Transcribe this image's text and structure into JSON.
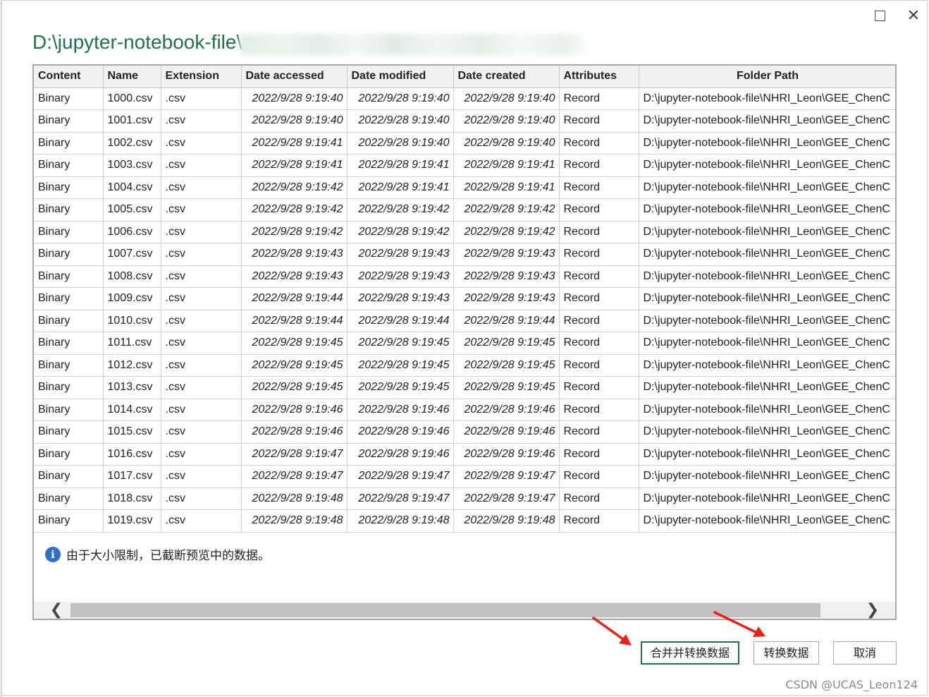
{
  "window": {
    "title": "D:\\jupyter-notebook-file\\",
    "maximize_icon": "maximize-icon",
    "close_icon": "close-icon",
    "close_glyph": "✕"
  },
  "table": {
    "columns": [
      "Content",
      "Name",
      "Extension",
      "Date accessed",
      "Date modified",
      "Date created",
      "Attributes",
      "Folder Path"
    ],
    "rows": [
      [
        "Binary",
        "1000.csv",
        ".csv",
        "2022/9/28 9:19:40",
        "2022/9/28 9:19:40",
        "2022/9/28 9:19:40",
        "Record",
        "D:\\jupyter-notebook-file\\NHRI_Leon\\GEE_ChenC"
      ],
      [
        "Binary",
        "1001.csv",
        ".csv",
        "2022/9/28 9:19:40",
        "2022/9/28 9:19:40",
        "2022/9/28 9:19:40",
        "Record",
        "D:\\jupyter-notebook-file\\NHRI_Leon\\GEE_ChenC"
      ],
      [
        "Binary",
        "1002.csv",
        ".csv",
        "2022/9/28 9:19:41",
        "2022/9/28 9:19:40",
        "2022/9/28 9:19:40",
        "Record",
        "D:\\jupyter-notebook-file\\NHRI_Leon\\GEE_ChenC"
      ],
      [
        "Binary",
        "1003.csv",
        ".csv",
        "2022/9/28 9:19:41",
        "2022/9/28 9:19:41",
        "2022/9/28 9:19:41",
        "Record",
        "D:\\jupyter-notebook-file\\NHRI_Leon\\GEE_ChenC"
      ],
      [
        "Binary",
        "1004.csv",
        ".csv",
        "2022/9/28 9:19:42",
        "2022/9/28 9:19:41",
        "2022/9/28 9:19:41",
        "Record",
        "D:\\jupyter-notebook-file\\NHRI_Leon\\GEE_ChenC"
      ],
      [
        "Binary",
        "1005.csv",
        ".csv",
        "2022/9/28 9:19:42",
        "2022/9/28 9:19:42",
        "2022/9/28 9:19:42",
        "Record",
        "D:\\jupyter-notebook-file\\NHRI_Leon\\GEE_ChenC"
      ],
      [
        "Binary",
        "1006.csv",
        ".csv",
        "2022/9/28 9:19:42",
        "2022/9/28 9:19:42",
        "2022/9/28 9:19:42",
        "Record",
        "D:\\jupyter-notebook-file\\NHRI_Leon\\GEE_ChenC"
      ],
      [
        "Binary",
        "1007.csv",
        ".csv",
        "2022/9/28 9:19:43",
        "2022/9/28 9:19:43",
        "2022/9/28 9:19:43",
        "Record",
        "D:\\jupyter-notebook-file\\NHRI_Leon\\GEE_ChenC"
      ],
      [
        "Binary",
        "1008.csv",
        ".csv",
        "2022/9/28 9:19:43",
        "2022/9/28 9:19:43",
        "2022/9/28 9:19:43",
        "Record",
        "D:\\jupyter-notebook-file\\NHRI_Leon\\GEE_ChenC"
      ],
      [
        "Binary",
        "1009.csv",
        ".csv",
        "2022/9/28 9:19:44",
        "2022/9/28 9:19:43",
        "2022/9/28 9:19:43",
        "Record",
        "D:\\jupyter-notebook-file\\NHRI_Leon\\GEE_ChenC"
      ],
      [
        "Binary",
        "1010.csv",
        ".csv",
        "2022/9/28 9:19:44",
        "2022/9/28 9:19:44",
        "2022/9/28 9:19:44",
        "Record",
        "D:\\jupyter-notebook-file\\NHRI_Leon\\GEE_ChenC"
      ],
      [
        "Binary",
        "1011.csv",
        ".csv",
        "2022/9/28 9:19:45",
        "2022/9/28 9:19:45",
        "2022/9/28 9:19:45",
        "Record",
        "D:\\jupyter-notebook-file\\NHRI_Leon\\GEE_ChenC"
      ],
      [
        "Binary",
        "1012.csv",
        ".csv",
        "2022/9/28 9:19:45",
        "2022/9/28 9:19:45",
        "2022/9/28 9:19:45",
        "Record",
        "D:\\jupyter-notebook-file\\NHRI_Leon\\GEE_ChenC"
      ],
      [
        "Binary",
        "1013.csv",
        ".csv",
        "2022/9/28 9:19:45",
        "2022/9/28 9:19:45",
        "2022/9/28 9:19:45",
        "Record",
        "D:\\jupyter-notebook-file\\NHRI_Leon\\GEE_ChenC"
      ],
      [
        "Binary",
        "1014.csv",
        ".csv",
        "2022/9/28 9:19:46",
        "2022/9/28 9:19:46",
        "2022/9/28 9:19:46",
        "Record",
        "D:\\jupyter-notebook-file\\NHRI_Leon\\GEE_ChenC"
      ],
      [
        "Binary",
        "1015.csv",
        ".csv",
        "2022/9/28 9:19:46",
        "2022/9/28 9:19:46",
        "2022/9/28 9:19:46",
        "Record",
        "D:\\jupyter-notebook-file\\NHRI_Leon\\GEE_ChenC"
      ],
      [
        "Binary",
        "1016.csv",
        ".csv",
        "2022/9/28 9:19:47",
        "2022/9/28 9:19:46",
        "2022/9/28 9:19:46",
        "Record",
        "D:\\jupyter-notebook-file\\NHRI_Leon\\GEE_ChenC"
      ],
      [
        "Binary",
        "1017.csv",
        ".csv",
        "2022/9/28 9:19:47",
        "2022/9/28 9:19:47",
        "2022/9/28 9:19:47",
        "Record",
        "D:\\jupyter-notebook-file\\NHRI_Leon\\GEE_ChenC"
      ],
      [
        "Binary",
        "1018.csv",
        ".csv",
        "2022/9/28 9:19:48",
        "2022/9/28 9:19:47",
        "2022/9/28 9:19:47",
        "Record",
        "D:\\jupyter-notebook-file\\NHRI_Leon\\GEE_ChenC"
      ],
      [
        "Binary",
        "1019.csv",
        ".csv",
        "2022/9/28 9:19:48",
        "2022/9/28 9:19:48",
        "2022/9/28 9:19:48",
        "Record",
        "D:\\jupyter-notebook-file\\NHRI_Leon\\GEE_ChenC"
      ]
    ]
  },
  "notice": {
    "icon": "info-icon",
    "icon_glyph": "i",
    "text": "由于大小限制，已截断预览中的数据。"
  },
  "scrollbar": {
    "left_glyph": "❮",
    "right_glyph": "❯"
  },
  "buttons": {
    "combine_transform": "合并并转换数据",
    "transform": "转换数据",
    "cancel": "取消"
  },
  "watermark": "CSDN @UCAS_Leon124",
  "colors": {
    "accent": "#217346",
    "annotation_arrow": "#e8211a",
    "info": "#2f6fc6"
  }
}
